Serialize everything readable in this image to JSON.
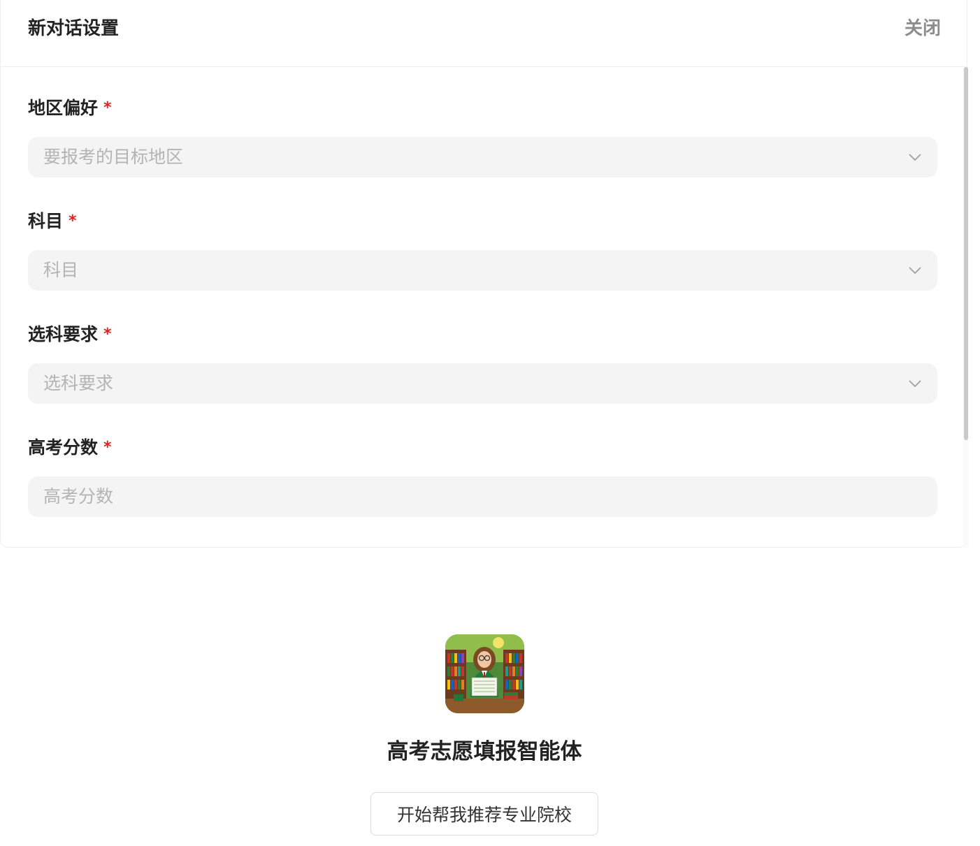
{
  "dialog": {
    "title": "新对话设置",
    "close_label": "关闭"
  },
  "fields": [
    {
      "label": "地区偏好",
      "required_mark": "*",
      "placeholder": "要报考的目标地区",
      "type": "select"
    },
    {
      "label": "科目",
      "required_mark": "*",
      "placeholder": "科目",
      "type": "select"
    },
    {
      "label": "选科要求",
      "required_mark": "*",
      "placeholder": "选科要求",
      "type": "select"
    },
    {
      "label": "高考分数",
      "required_mark": "*",
      "placeholder": "高考分数",
      "type": "input"
    }
  ],
  "agent": {
    "name": "高考志愿填报智能体",
    "start_button_label": "开始帮我推荐专业院校",
    "avatar_icon": "teacher-library-avatar"
  },
  "colors": {
    "required": "#e02020",
    "field_bg": "#f4f4f4",
    "placeholder": "#b4b4b4",
    "close": "#8c8c8c"
  }
}
